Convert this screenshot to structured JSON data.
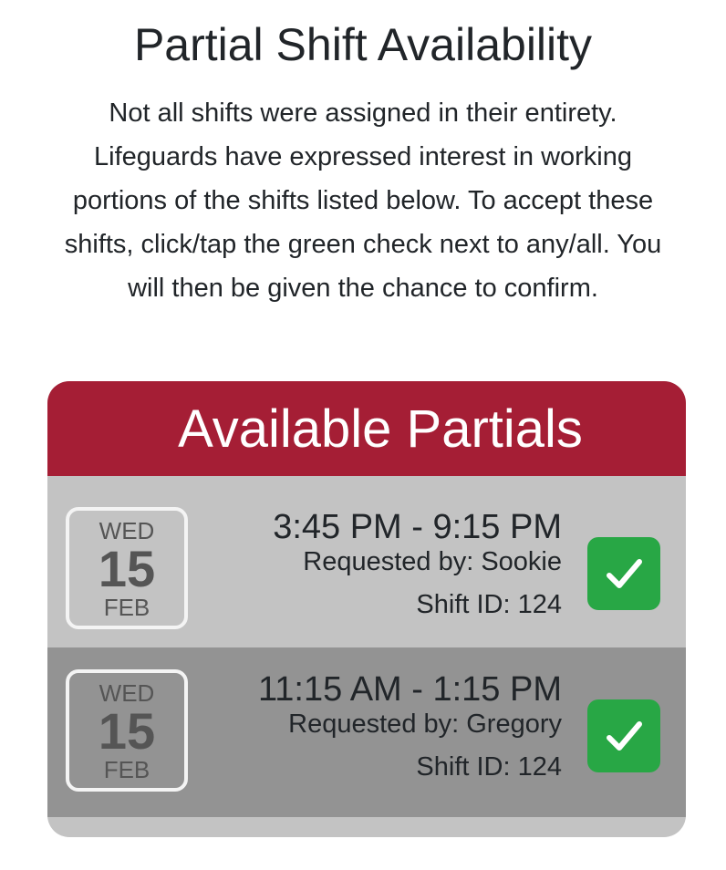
{
  "page": {
    "title": "Partial Shift Availability",
    "intro": "Not all shifts were assigned in their entirety. Lifeguards have expressed interest in working portions of the shifts listed below. To accept these shifts, click/tap the green check next to any/all. You will then be given the chance to confirm."
  },
  "card": {
    "title": "Available Partials",
    "accent_color": "#a51e35",
    "check_color": "#28a745"
  },
  "shifts": [
    {
      "dow": "WED",
      "day": "15",
      "month": "FEB",
      "time": "3:45 PM - 9:15 PM",
      "requested_by": "Requested by: Sookie",
      "shift_id": "Shift ID: 124",
      "accept_icon": "check-icon"
    },
    {
      "dow": "WED",
      "day": "15",
      "month": "FEB",
      "time": "11:15 AM - 1:15 PM",
      "requested_by": "Requested by: Gregory",
      "shift_id": "Shift ID: 124",
      "accept_icon": "check-icon"
    }
  ]
}
